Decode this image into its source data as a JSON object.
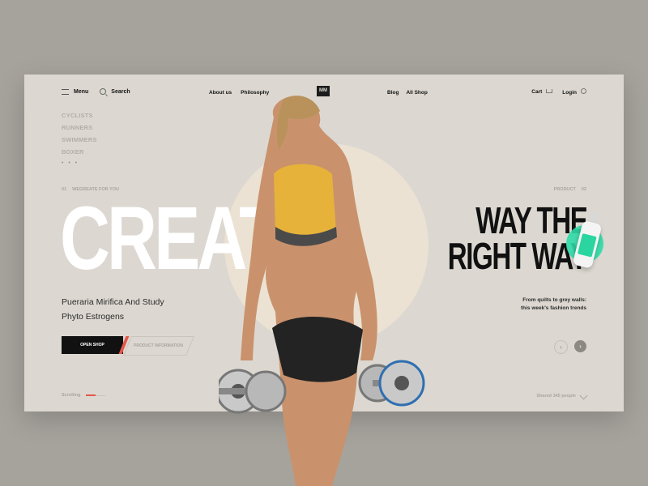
{
  "nav": {
    "menu_label": "Menu",
    "search_label": "Search",
    "about_label": "About us",
    "philosophy_label": "Philosophy",
    "logo_text": "MM",
    "blog_label": "Blog",
    "all_shop_label": "All Shop",
    "cart_label": "Cart",
    "login_label": "Login"
  },
  "categories": [
    "CYCLISTS",
    "RUNNERS",
    "SWIMMERS",
    "BOXER"
  ],
  "more_dots": "• • •",
  "left_section": {
    "index": "01",
    "label": "WEGREATE FOR YOU"
  },
  "right_section": {
    "label": "PRODUCT",
    "index": "02"
  },
  "hero": {
    "big_word": "CREATE",
    "subtitle_line1": "Pueraria Mirifica And Study",
    "subtitle_line2": "Phyto Estrogens"
  },
  "headline_right": {
    "line1": "WAY THE",
    "line2": "RIGHT WAY"
  },
  "desc_right": "From quilts to grey walls: this week's fashion trends",
  "buttons": {
    "open_shop": "OPEN SHOP",
    "product_info": "PRODUCT INFORMATION"
  },
  "arrows": {
    "prev": "‹",
    "next": "›"
  },
  "footer": {
    "scrolling": "Scrolling",
    "shared": "Shared 345 people"
  },
  "colors": {
    "accent": "#e2584a",
    "mint": "#2fdca7",
    "card": "#dcd8d1",
    "circle": "#ebe2d3"
  }
}
